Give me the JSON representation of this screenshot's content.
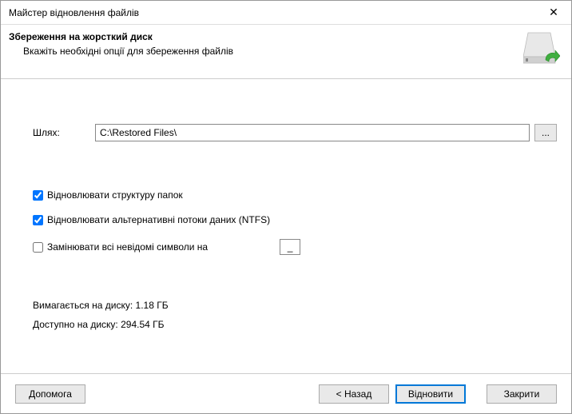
{
  "window": {
    "title": "Майстер відновлення файлів"
  },
  "header": {
    "title": "Збереження на жорсткий диск",
    "subtitle": "Вкажіть необхідні опції для збереження файлів"
  },
  "path": {
    "label": "Шлях:",
    "value": "C:\\Restored Files\\",
    "browse": "..."
  },
  "options": {
    "restore_structure": "Відновлювати структуру папок",
    "restore_ads": "Відновлювати альтернативні потоки даних (NTFS)",
    "replace_unknown": "Замінювати всі невідомі символи на",
    "replace_char": "_"
  },
  "stats": {
    "required_label": "Вимагається на диску:",
    "required_value": "1.18 ГБ",
    "available_label": "Доступно на диску:",
    "available_value": "294.54 ГБ"
  },
  "footer": {
    "help": "Допомога",
    "back": "< Назад",
    "restore": "Відновити",
    "close": "Закрити"
  }
}
